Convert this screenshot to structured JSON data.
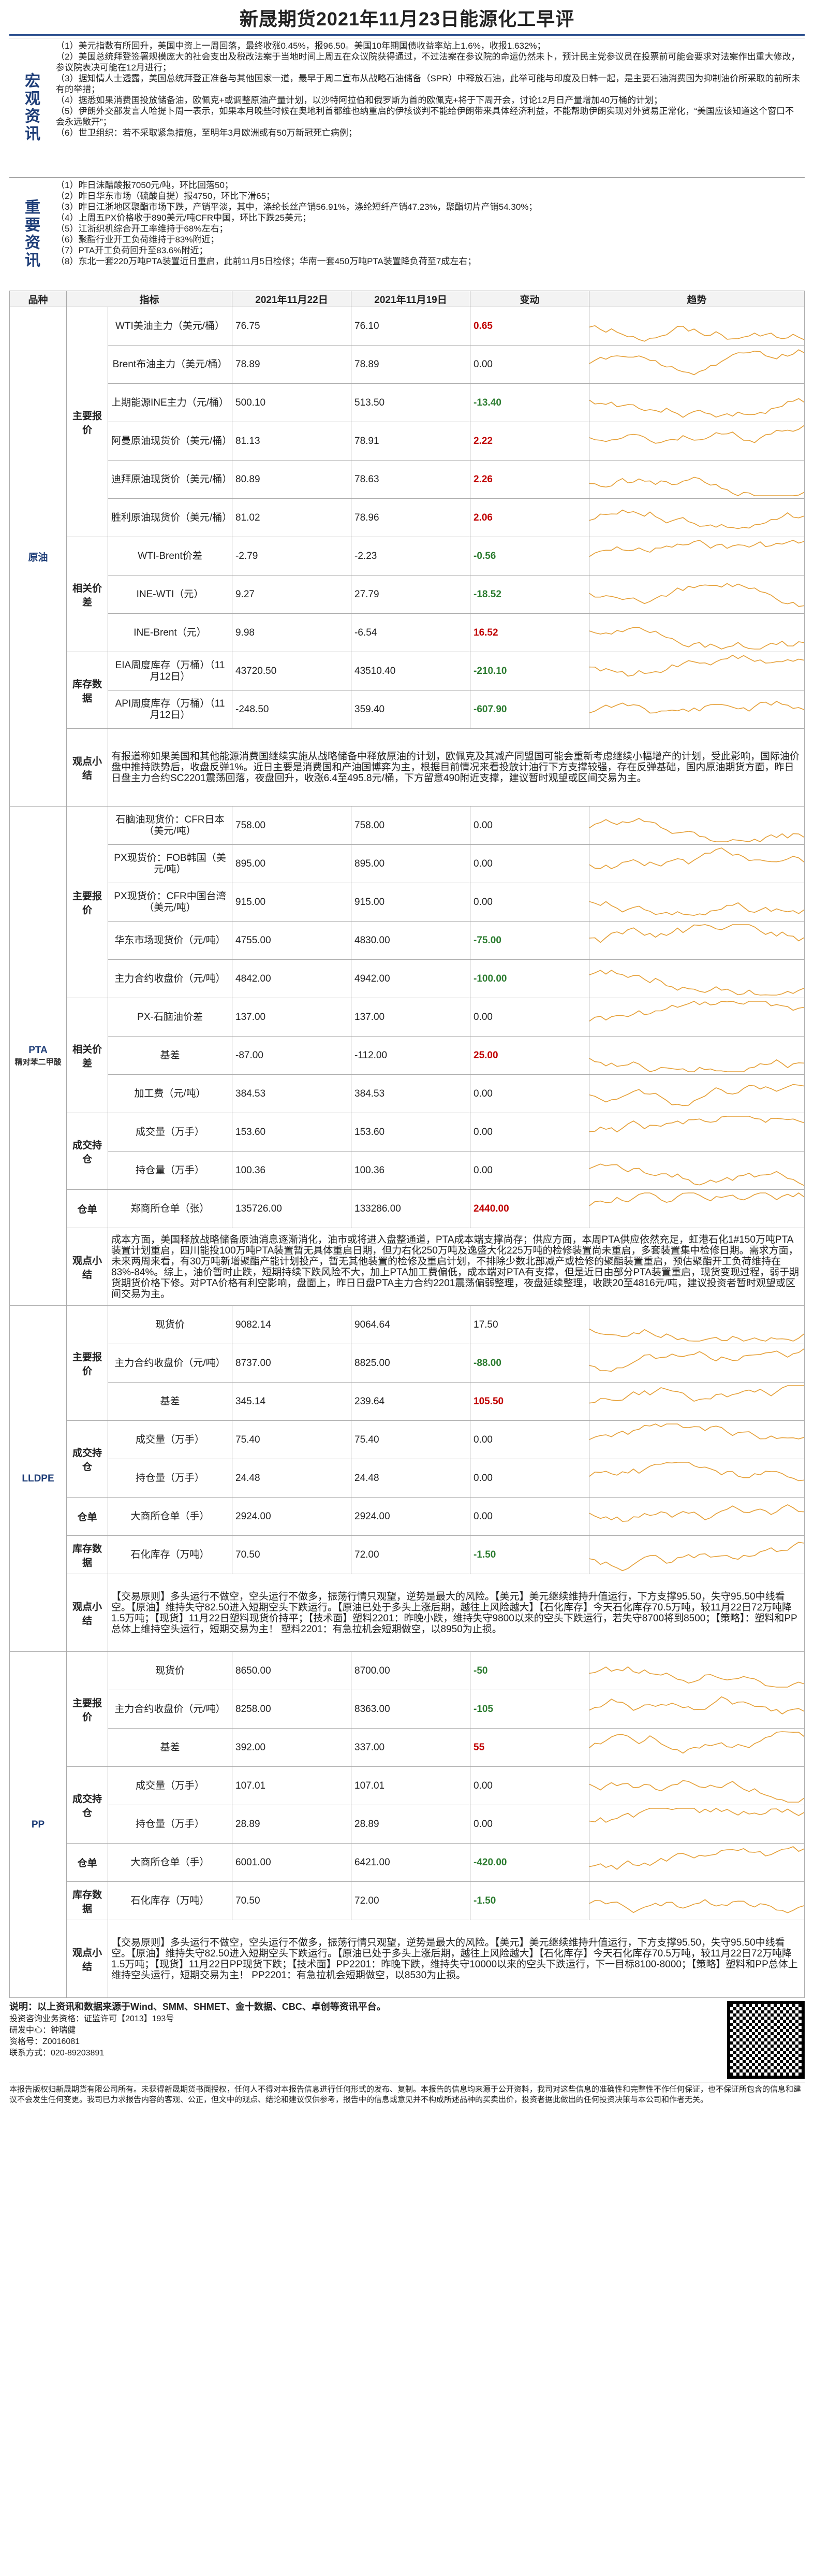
{
  "title": "新晟期货2021年11月23日能源化工早评",
  "macro": {
    "label": "宏观资讯",
    "items": [
      "（1）美元指数有所回升，美国中资上一周回落，最终收涨0.45%，报96.50。美国10年期国债收益率站上1.6%，收报1.632%；",
      "（2）美国总统拜登签署规模庞大的社会支出及税改法案于当地时间上周五在众议院获得通过，不过法案在参议院的命运仍然未卜，预计民主党参议员在投票前可能会要求对法案作出重大修改，参议院表决可能在12月进行；",
      "（3）据知情人士透露，美国总统拜登正准备与其他国家一道，最早于周二宣布从战略石油储备（SPR）中释放石油，此举可能与印度及日韩一起，是主要石油消费国为抑制油价所采取的前所未有的举措；",
      "（4）据悉如果消费国投放储备油，欧佩克+或调整原油产量计划，以沙特阿拉伯和俄罗斯为首的欧佩克+将于下周开会，讨论12月日产量增加40万桶的计划；",
      "（5）伊朗外交部发言人哈提卜周一表示，如果本月晚些时候在奥地利首都维也纳重启的伊核谈判不能给伊朗带来具体经济利益，不能帮助伊朗实现对外贸易正常化，“美国应该知道这个窗口不会永远敞开”；",
      "（6）世卫组织：若不采取紧急措施，至明年3月欧洲或有50万新冠死亡病例；"
    ]
  },
  "industry": {
    "label": "重要资讯",
    "items": [
      "（1）昨日沫醋酸报7050元/吨，环比回落50；",
      "（2）昨日华东市场（硫酸自提）报4750，环比下滑65；",
      "（3）昨日江浙地区聚酯市场下跌，产销平淡，其中，涤纶长丝产销56.91%，涤纶短纤产销47.23%，聚酯切片产销54.30%；",
      "（4）上周五PX价格收于890美元/吨CFR中国，环比下跌25美元；",
      "（5）江浙织机综合开工率维持于68%左右；",
      "（6）聚酯行业开工负荷维持于83%附近；",
      "（7）PTA开工负荷回升至83.6%附近；",
      "（8）东北一套220万吨PTA装置近日重启，此前11月5日检修；华南一套450万吨PTA装置降负荷至7成左右；"
    ]
  },
  "header": {
    "c1": "品种",
    "c2": "指标",
    "c3": "2021年11月22日",
    "c4": "2021年11月19日",
    "c5": "变动",
    "c6": "趋势"
  },
  "crude": {
    "name": "原油",
    "groups": [
      {
        "label": "主要报价",
        "rows": [
          {
            "ind": "WTI美油主力（美元/桶）",
            "a": "76.75",
            "b": "76.10",
            "chg": "0.65",
            "dir": 1
          },
          {
            "ind": "Brent布油主力（美元/桶）",
            "a": "78.89",
            "b": "78.89",
            "chg": "0.00",
            "dir": 0
          },
          {
            "ind": "上期能源INE主力（元/桶）",
            "a": "500.10",
            "b": "513.50",
            "chg": "-13.40",
            "dir": -1
          },
          {
            "ind": "阿曼原油现货价（美元/桶）",
            "a": "81.13",
            "b": "78.91",
            "chg": "2.22",
            "dir": 1
          },
          {
            "ind": "迪拜原油现货价（美元/桶）",
            "a": "80.89",
            "b": "78.63",
            "chg": "2.26",
            "dir": 1
          },
          {
            "ind": "胜利原油现货价（美元/桶）",
            "a": "81.02",
            "b": "78.96",
            "chg": "2.06",
            "dir": 1
          }
        ]
      },
      {
        "label": "相关价差",
        "rows": [
          {
            "ind": "WTI-Brent价差",
            "a": "-2.79",
            "b": "-2.23",
            "chg": "-0.56",
            "dir": -1
          },
          {
            "ind": "INE-WTI（元）",
            "a": "9.27",
            "b": "27.79",
            "chg": "-18.52",
            "dir": -1
          },
          {
            "ind": "INE-Brent（元）",
            "a": "9.98",
            "b": "-6.54",
            "chg": "16.52",
            "dir": 1
          }
        ]
      },
      {
        "label": "库存数据",
        "rows": [
          {
            "ind": "EIA周度库存（万桶）（11月12日）",
            "a": "43720.50",
            "b": "43510.40",
            "chg": "-210.10",
            "dir": -1
          },
          {
            "ind": "API周度库存（万桶）（11月12日）",
            "a": "-248.50",
            "b": "359.40",
            "chg": "-607.90",
            "dir": -1
          }
        ]
      }
    ],
    "view_label": "观点小结",
    "view": "有报道称如果美国和其他能源消费国继续实施从战略储备中释放原油的计划，欧佩克及其减产同盟国可能会重新考虑继续小幅增产的计划，受此影响，国际油价盘中推持跌势后，收盘反弹1%。近日主要是消费国和产油国博弈为主，根据目前情况来看投放计油行下方支撑较强，存在反弹基础，国内原油期货方面，昨日日盘主力合约SC2201震荡回落，夜盘回升，收涨6.4至495.8元/桶，下方留意490附近支撑，建议暂时观望或区间交易为主。"
  },
  "pta": {
    "name": "PTA",
    "sub": "精对苯二甲酸",
    "groups": [
      {
        "label": "主要报价",
        "rows": [
          {
            "ind": "石脑油现货价：CFR日本（美元/吨）",
            "a": "758.00",
            "b": "758.00",
            "chg": "0.00",
            "dir": 0
          },
          {
            "ind": "PX现货价：FOB韩国（美元/吨）",
            "a": "895.00",
            "b": "895.00",
            "chg": "0.00",
            "dir": 0
          },
          {
            "ind": "PX现货价：CFR中国台湾（美元/吨）",
            "a": "915.00",
            "b": "915.00",
            "chg": "0.00",
            "dir": 0
          },
          {
            "ind": "华东市场现货价（元/吨）",
            "a": "4755.00",
            "b": "4830.00",
            "chg": "-75.00",
            "dir": -1
          },
          {
            "ind": "主力合约收盘价（元/吨）",
            "a": "4842.00",
            "b": "4942.00",
            "chg": "-100.00",
            "dir": -1
          }
        ]
      },
      {
        "label": "相关价差",
        "rows": [
          {
            "ind": "PX-石脑油价差",
            "a": "137.00",
            "b": "137.00",
            "chg": "0.00",
            "dir": 0
          },
          {
            "ind": "基差",
            "a": "-87.00",
            "b": "-112.00",
            "chg": "25.00",
            "dir": 1
          },
          {
            "ind": "加工费（元/吨）",
            "a": "384.53",
            "b": "384.53",
            "chg": "0.00",
            "dir": 0
          }
        ]
      },
      {
        "label": "成交持仓",
        "rows": [
          {
            "ind": "成交量（万手）",
            "a": "153.60",
            "b": "153.60",
            "chg": "0.00",
            "dir": 0
          },
          {
            "ind": "持仓量（万手）",
            "a": "100.36",
            "b": "100.36",
            "chg": "0.00",
            "dir": 0
          }
        ]
      },
      {
        "label": "仓单",
        "rows": [
          {
            "ind": "郑商所仓单（张）",
            "a": "135726.00",
            "b": "133286.00",
            "chg": "2440.00",
            "dir": 1
          }
        ]
      }
    ],
    "view_label": "观点小结",
    "view": "成本方面，美国释放战略储备原油消息逐渐消化，油市或将进入盘整通道，PTA成本端支撑尚存；供应方面，本周PTA供应依然充足，虹港石化1#150万吨PTA装置计划重启，四川能投100万吨PTA装置暂无具体重启日期，但力右化250万吨及逸盛大化225万吨的检修装置尚未重启，多套装置集中检修日期。需求方面，未来两周来看，有30万吨新增聚酯产能计划投产，暂无其他装置的检修及重启计划，不排除少数北部减产或检修的聚酯装置重启，预估聚酯开工负荷维持在83%-84%。综上，油价暂时止跌，短期持续下跌风险不大，加上PTA加工费偏低，成本端对PTA有支撑，但是近日由部分PTA装置重启，现货变现过程，弱于期货期货价格下修。对PTA价格有利空影响，盘面上，昨日日盘PTA主力合约2201震荡偏弱整理，夜盘延续整理，收跌20至4816元/吨，建议投资者暂时观望或区间交易为主。"
  },
  "lldpe": {
    "name": "LLDPE",
    "groups": [
      {
        "label": "主要报价",
        "rows": [
          {
            "ind": "现货价",
            "a": "9082.14",
            "b": "9064.64",
            "chg": "17.50",
            "dir": 0
          },
          {
            "ind": "主力合约收盘价（元/吨）",
            "a": "8737.00",
            "b": "8825.00",
            "chg": "-88.00",
            "dir": -1
          },
          {
            "ind": "基差",
            "a": "345.14",
            "b": "239.64",
            "chg": "105.50",
            "dir": 1
          }
        ]
      },
      {
        "label": "成交持仓",
        "rows": [
          {
            "ind": "成交量（万手）",
            "a": "75.40",
            "b": "75.40",
            "chg": "0.00",
            "dir": 0
          },
          {
            "ind": "持仓量（万手）",
            "a": "24.48",
            "b": "24.48",
            "chg": "0.00",
            "dir": 0
          }
        ]
      },
      {
        "label": "仓单",
        "rows": [
          {
            "ind": "大商所仓单（手）",
            "a": "2924.00",
            "b": "2924.00",
            "chg": "0.00",
            "dir": 0
          }
        ]
      },
      {
        "label": "库存数据",
        "rows": [
          {
            "ind": "石化库存（万吨）",
            "a": "70.50",
            "b": "72.00",
            "chg": "-1.50",
            "dir": -1
          }
        ]
      }
    ],
    "view_label": "观点小结",
    "view": "【交易原则】多头运行不做空，空头运行不做多，振荡行情只观望，逆势是最大的风险。【美元】美元继续维持升值运行，下方支撑95.50，失守95.50中线看空。【原油】维持失守82.50进入短期空头下跌运行。【原油已处于多头上涨后期，越往上风险越大】【石化库存】今天石化库存70.5万吨，较11月22日72万吨降1.5万吨；【现货】11月22日塑料现货价持平；【技术面】塑料2201：昨晚小跌，维持失守9800以来的空头下跌运行，若失守8700将到8500；【策略】：塑料和PP总体上维持空头运行，短期交易为主！ 塑料2201：有急拉机会短期做空，以8950为止损。"
  },
  "pp": {
    "name": "PP",
    "groups": [
      {
        "label": "主要报价",
        "rows": [
          {
            "ind": "现货价",
            "a": "8650.00",
            "b": "8700.00",
            "chg": "-50",
            "dir": -1
          },
          {
            "ind": "主力合约收盘价（元/吨）",
            "a": "8258.00",
            "b": "8363.00",
            "chg": "-105",
            "dir": -1
          },
          {
            "ind": "基差",
            "a": "392.00",
            "b": "337.00",
            "chg": "55",
            "dir": 1
          }
        ]
      },
      {
        "label": "成交持仓",
        "rows": [
          {
            "ind": "成交量（万手）",
            "a": "107.01",
            "b": "107.01",
            "chg": "0.00",
            "dir": 0
          },
          {
            "ind": "持仓量（万手）",
            "a": "28.89",
            "b": "28.89",
            "chg": "0.00",
            "dir": 0
          }
        ]
      },
      {
        "label": "仓单",
        "rows": [
          {
            "ind": "大商所仓单（手）",
            "a": "6001.00",
            "b": "6421.00",
            "chg": "-420.00",
            "dir": -1
          }
        ]
      },
      {
        "label": "库存数据",
        "rows": [
          {
            "ind": "石化库存（万吨）",
            "a": "70.50",
            "b": "72.00",
            "chg": "-1.50",
            "dir": -1
          }
        ]
      }
    ],
    "view_label": "观点小结",
    "view": "【交易原则】多头运行不做空，空头运行不做多，振荡行情只观望，逆势是最大的风险。【美元】美元继续维持升值运行，下方支撑95.50，失守95.50中线看空。【原油】维持失守82.50进入短期空头下跌运行。【原油已处于多头上涨后期，越往上风险越大】【石化库存】今天石化库存70.5万吨，较11月22日72万吨降1.5万吨；【现货】11月22日PP现货下跌；【技术面】PP2201：昨晚下跌，维持失守10000以来的空头下跌运行，下一目标8100-8000；【策略】塑料和PP总体上维持空头运行，短期交易为主！ PP2201：有急拉机会短期做空，以8530为止损。"
  },
  "footer": {
    "note": "说明：以上资讯和数据来源于Wind、SMM、SHMET、金十数据、CBC、卓创等资讯平台。",
    "license": "投资咨询业务资格：证监许可【2013】193号",
    "analyst": "研发中心：钟瑞健",
    "cert": "资格号：Z0016081",
    "phone": "联系方式：020-89203891",
    "disclaimer": "本报告版权归新晟期货有限公司所有。未获得新晟期货书面授权，任何人不得对本报告信息进行任何形式的发布、复制。本报告的信息均来源于公开资料，我司对这些信息的准确性和完整性不作任何保证，也不保证所包含的信息和建议不会发生任何变更。我司已力求报告内容的客观、公正，但文中的观点、结论和建议仅供参考，报告中的信息或意见并不构成所述品种的买卖出价，投资者据此做出的任何投资决策与本公司和作者无关。"
  }
}
